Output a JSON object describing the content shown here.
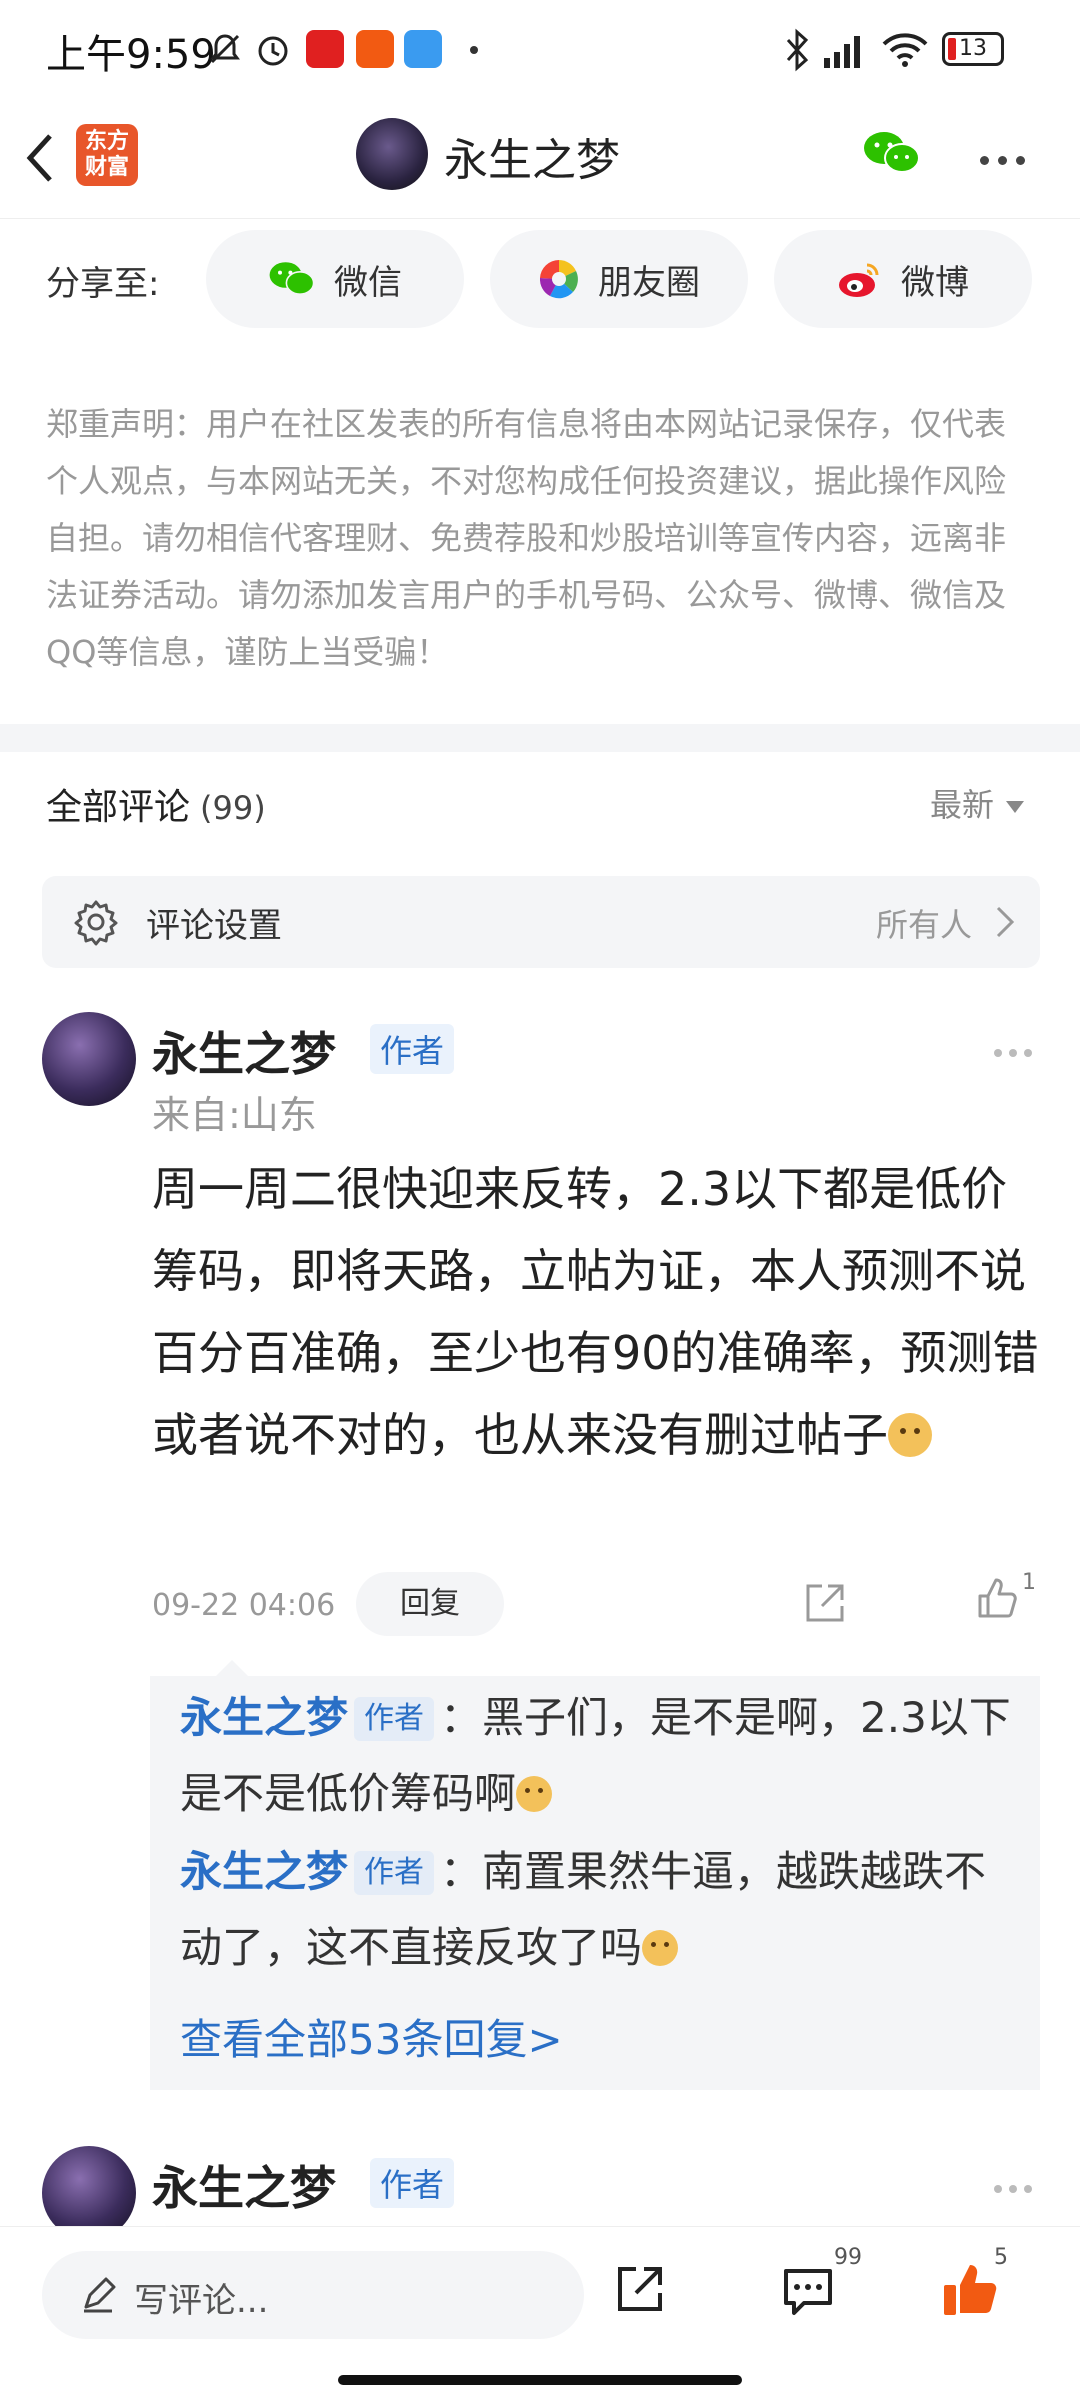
{
  "status_bar": {
    "time": "上午9:59",
    "battery": "13"
  },
  "header": {
    "logo_text": "东方\n财富",
    "title": "永生之梦"
  },
  "share": {
    "label": "分享至:",
    "targets": [
      {
        "label": "微信",
        "icon": "wechat-icon"
      },
      {
        "label": "朋友圈",
        "icon": "moments-icon"
      },
      {
        "label": "微博",
        "icon": "weibo-icon"
      }
    ]
  },
  "disclaimer": "郑重声明：用户在社区发表的所有信息将由本网站记录保存，仅代表个人观点，与本网站无关，不对您构成任何投资建议，据此操作风险自担。请勿相信代客理财、免费荐股和炒股培训等宣传内容，远离非法证券活动。请勿添加发言用户的手机号码、公众号、微博、微信及QQ等信息，谨防上当受骗！",
  "comments": {
    "title": "全部评论",
    "count": "(99)",
    "sort": "最新",
    "settings_label": "评论设置",
    "settings_value": "所有人"
  },
  "comment1": {
    "name": "永生之梦",
    "tag": "作者",
    "location": "来自:山东",
    "body": "周一周二很快迎来反转，2.3以下都是低价筹码，即将天路，立帖为证，本人预测不说百分百准确，至少也有90的准确率，预测错或者说不对的，也从来没有删过帖子",
    "time": "09-22 04:06",
    "reply_label": "回复",
    "likes": "1",
    "replies": [
      {
        "name": "永生之梦",
        "tag": "作者",
        "text": "：黑子们，是不是啊，2.3以下是不是低价筹码啊"
      },
      {
        "name": "永生之梦",
        "tag": "作者",
        "text": "：南置果然牛逼，越跌越跌不动了，这不直接反攻了吗"
      }
    ],
    "view_all": "查看全部53条回复>"
  },
  "comment2": {
    "name": "永生之梦",
    "tag": "作者"
  },
  "bottom_bar": {
    "placeholder": "写评论...",
    "comment_count": "99",
    "like_count": "5"
  },
  "colors": {
    "accent_blue": "#2a6fc6",
    "like_orange": "#f25a12",
    "logo_orange": "#e8562a"
  }
}
